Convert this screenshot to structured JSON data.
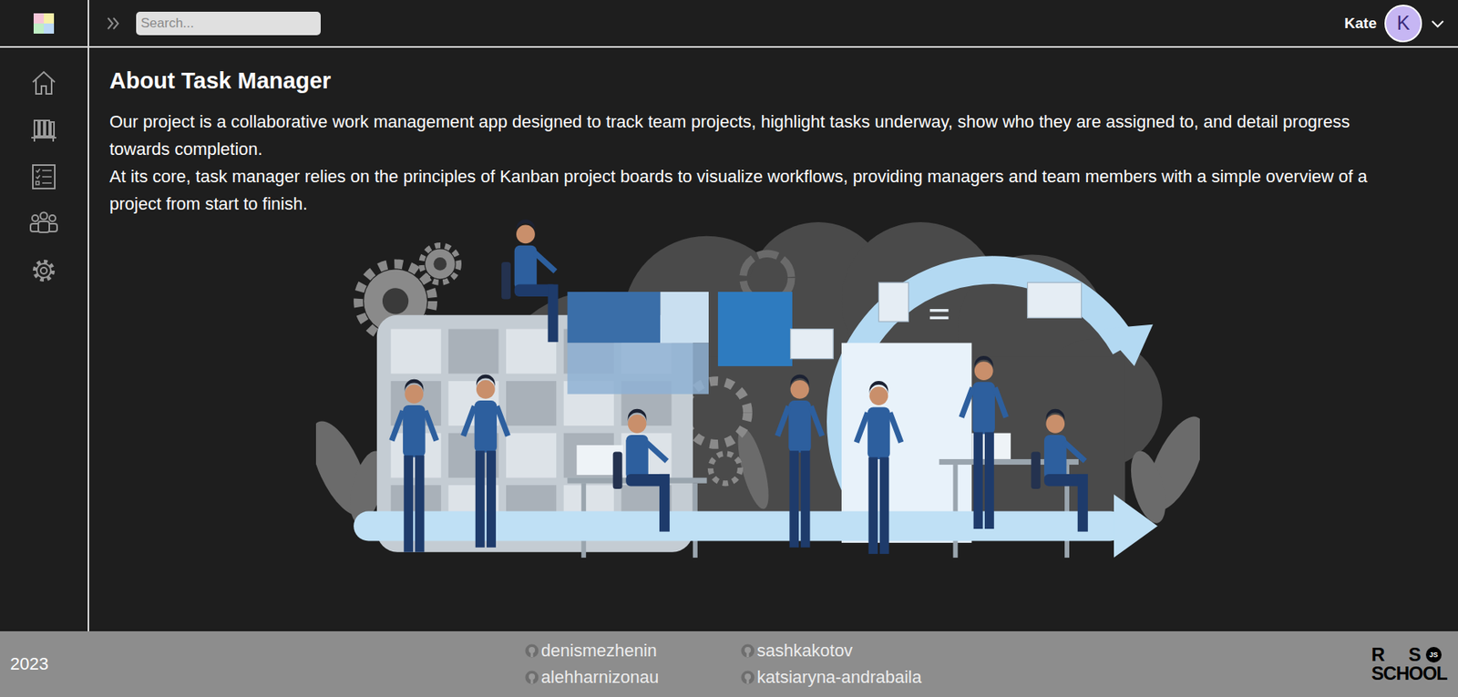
{
  "header": {
    "search": {
      "placeholder": "Search..."
    },
    "user": {
      "name": "Kate",
      "initial": "K"
    }
  },
  "page": {
    "title": "About Task Manager",
    "paragraphs": [
      "Our project is a collaborative work management app designed to track team projects, highlight tasks underway, show who they are assigned to, and detail progress towards completion.",
      "At its core, task manager relies on the principles of Kanban project boards to visualize workflows, providing managers and team members with a simple overview of a project from start to finish."
    ]
  },
  "footer": {
    "year": "2023",
    "contributors": [
      "denismezhenin",
      "sashkakotov",
      "alehharnizonau",
      "katsiaryna-andrabaila"
    ],
    "logo": {
      "top": [
        "R",
        "S"
      ],
      "bottom": "SCHOOL",
      "badge": "JS"
    }
  }
}
